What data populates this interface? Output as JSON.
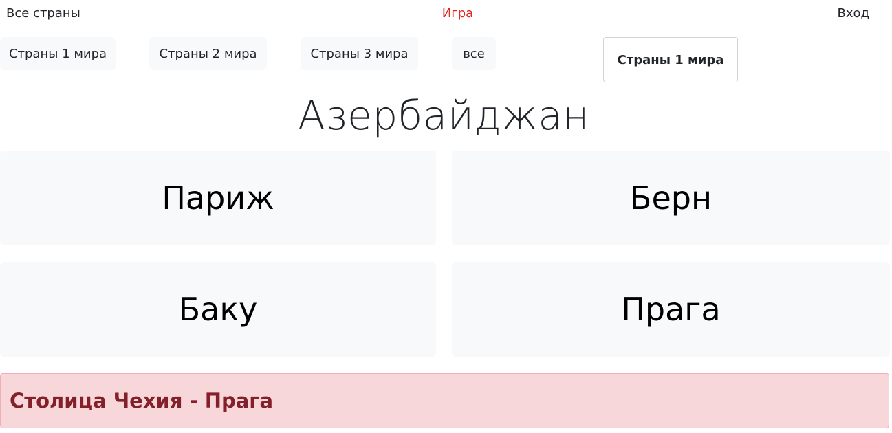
{
  "nav": {
    "all_countries": "Все страны",
    "game": "Игра",
    "login": "Вход"
  },
  "filters": [
    {
      "label": "Страны 1 мира"
    },
    {
      "label": "Страны 2 мира"
    },
    {
      "label": "Страны 3 мира"
    },
    {
      "label": "все"
    }
  ],
  "mode_select": {
    "selected": "Страны 1 мира"
  },
  "question": {
    "country": "Азербайджан"
  },
  "answers": [
    {
      "label": "Париж"
    },
    {
      "label": "Берн"
    },
    {
      "label": "Баку"
    },
    {
      "label": "Прага"
    }
  ],
  "result": {
    "message": "Столица Чехия - Прага",
    "status_color": "#f8d7da"
  },
  "colors": {
    "accent_link": "#e0281e",
    "button_bg": "#f8f9fa",
    "alert_text": "#842029"
  }
}
